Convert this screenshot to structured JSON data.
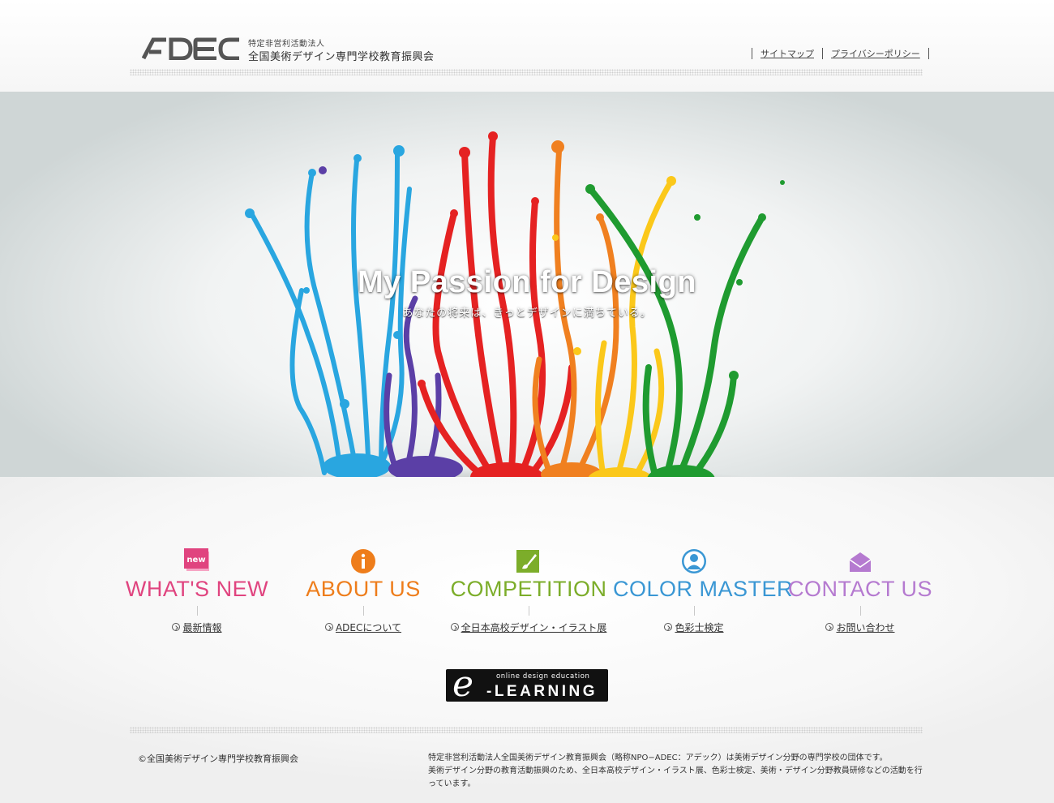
{
  "header": {
    "logo_text": "ADEC",
    "org_type": "特定非営利活動法人",
    "org_name": "全国美術デザイン専門学校教育振興会",
    "links": [
      "サイトマップ",
      "プライバシーポリシー"
    ]
  },
  "hero": {
    "title": "My Passion for Design",
    "subtitle": "あなたの将来は、きっとデザインに満ちている。"
  },
  "nav": [
    {
      "title": "WHAT'S NEW",
      "link": "最新情報",
      "icon": "new-badge-icon",
      "color": "#e0447f",
      "badge": "new"
    },
    {
      "title": "ABOUT US",
      "link": "ADECについて",
      "icon": "info-icon",
      "color": "#ee7d1b"
    },
    {
      "title": "COMPETITION",
      "link": "全日本高校デザイン・イラスト展",
      "icon": "brush-icon",
      "color": "#7cad2a"
    },
    {
      "title": "COLOR MASTER",
      "link": "色彩士検定",
      "icon": "person-icon",
      "color": "#3a97d4"
    },
    {
      "title": "CONTACT US",
      "link": "お問い合わせ",
      "icon": "envelope-icon",
      "color": "#b57ad0"
    }
  ],
  "elearning": {
    "letter": "e",
    "small": "online design education",
    "big": "-LEARNING"
  },
  "footer": {
    "copyright": "©全国美術デザイン専門学校教育振興会",
    "description_lines": [
      "特定非営利活動法人全国美術デザイン教育振興会（略称NPO−ADEC：アデック）は美術デザイン分野の専門学校の団体です。",
      "美術デザイン分野の教育活動振興のため、全日本高校デザイン・イラスト展、色彩士検定、美術・デザイン分野教員研修などの活動を行",
      "っています。"
    ]
  }
}
